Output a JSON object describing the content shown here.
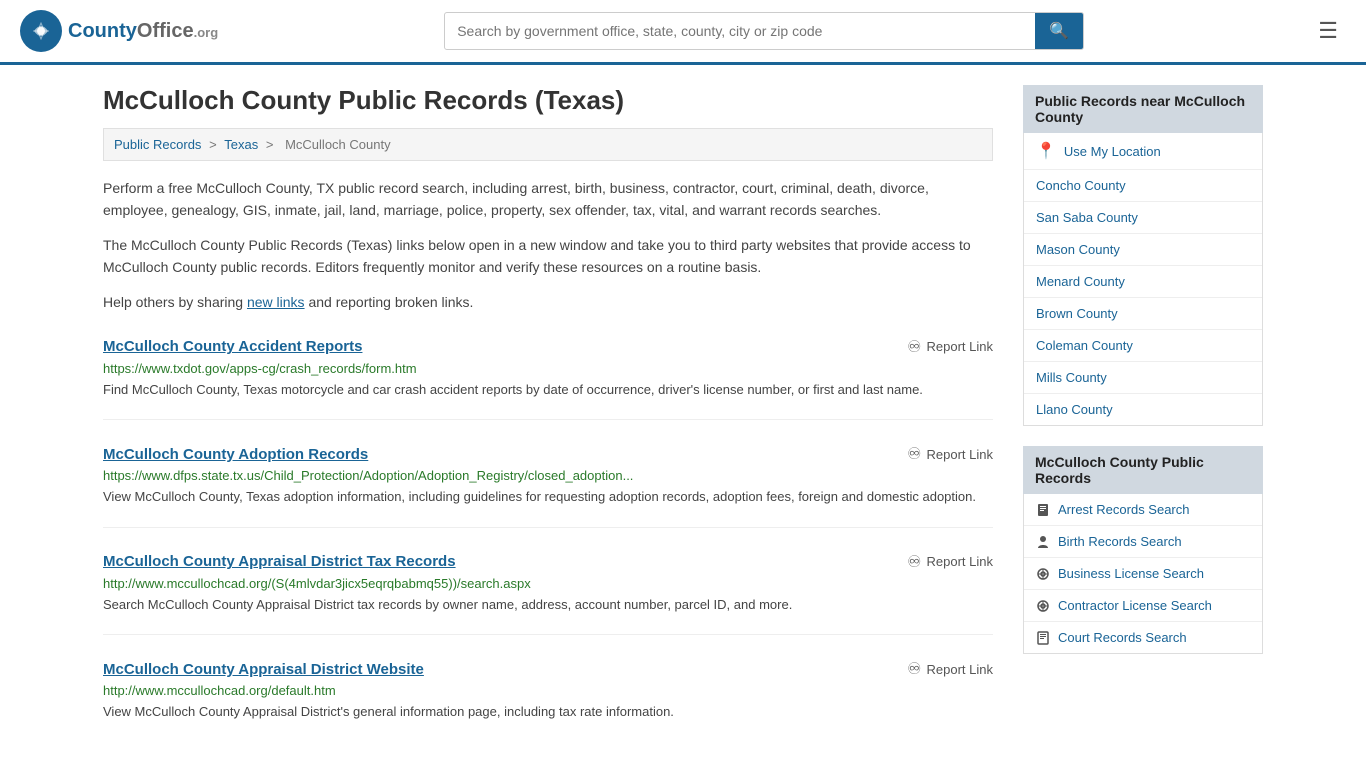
{
  "header": {
    "logo_text": "County",
    "logo_org": "Office",
    "logo_domain": ".org",
    "search_placeholder": "Search by government office, state, county, city or zip code",
    "search_value": ""
  },
  "page": {
    "title": "McCulloch County Public Records (Texas)",
    "breadcrumb": {
      "items": [
        "Public Records",
        "Texas",
        "McCulloch County"
      ]
    },
    "intro1": "Perform a free McCulloch County, TX public record search, including arrest, birth, business, contractor, court, criminal, death, divorce, employee, genealogy, GIS, inmate, jail, land, marriage, police, property, sex offender, tax, vital, and warrant records searches.",
    "intro2": "The McCulloch County Public Records (Texas) links below open in a new window and take you to third party websites that provide access to McCulloch County public records. Editors frequently monitor and verify these resources on a routine basis.",
    "intro3_prefix": "Help others by sharing ",
    "intro3_link": "new links",
    "intro3_suffix": " and reporting broken links."
  },
  "records": [
    {
      "title": "McCulloch County Accident Reports",
      "url": "https://www.txdot.gov/apps-cg/crash_records/form.htm",
      "desc": "Find McCulloch County, Texas motorcycle and car crash accident reports by date of occurrence, driver's license number, or first and last name.",
      "report_label": "Report Link"
    },
    {
      "title": "McCulloch County Adoption Records",
      "url": "https://www.dfps.state.tx.us/Child_Protection/Adoption/Adoption_Registry/closed_adoption...",
      "desc": "View McCulloch County, Texas adoption information, including guidelines for requesting adoption records, adoption fees, foreign and domestic adoption.",
      "report_label": "Report Link"
    },
    {
      "title": "McCulloch County Appraisal District Tax Records",
      "url": "http://www.mccullochcad.org/(S(4mlvdar3jicx5eqrqbabmq55))/search.aspx",
      "desc": "Search McCulloch County Appraisal District tax records by owner name, address, account number, parcel ID, and more.",
      "report_label": "Report Link"
    },
    {
      "title": "McCulloch County Appraisal District Website",
      "url": "http://www.mccullochcad.org/default.htm",
      "desc": "View McCulloch County Appraisal District's general information page, including tax rate information.",
      "report_label": "Report Link"
    }
  ],
  "sidebar": {
    "nearby_title": "Public Records near McCulloch County",
    "nearby_items": [
      {
        "label": "Use My Location",
        "icon": "location"
      },
      {
        "label": "Concho County"
      },
      {
        "label": "San Saba County"
      },
      {
        "label": "Mason County"
      },
      {
        "label": "Menard County"
      },
      {
        "label": "Brown County"
      },
      {
        "label": "Coleman County"
      },
      {
        "label": "Mills County"
      },
      {
        "label": "Llano County"
      }
    ],
    "records_title": "McCulloch County Public Records",
    "records_items": [
      {
        "label": "Arrest Records Search",
        "icon": "arrest"
      },
      {
        "label": "Birth Records Search",
        "icon": "birth"
      },
      {
        "label": "Business License Search",
        "icon": "business"
      },
      {
        "label": "Contractor License Search",
        "icon": "contractor"
      },
      {
        "label": "Court Records Search",
        "icon": "court"
      }
    ]
  }
}
